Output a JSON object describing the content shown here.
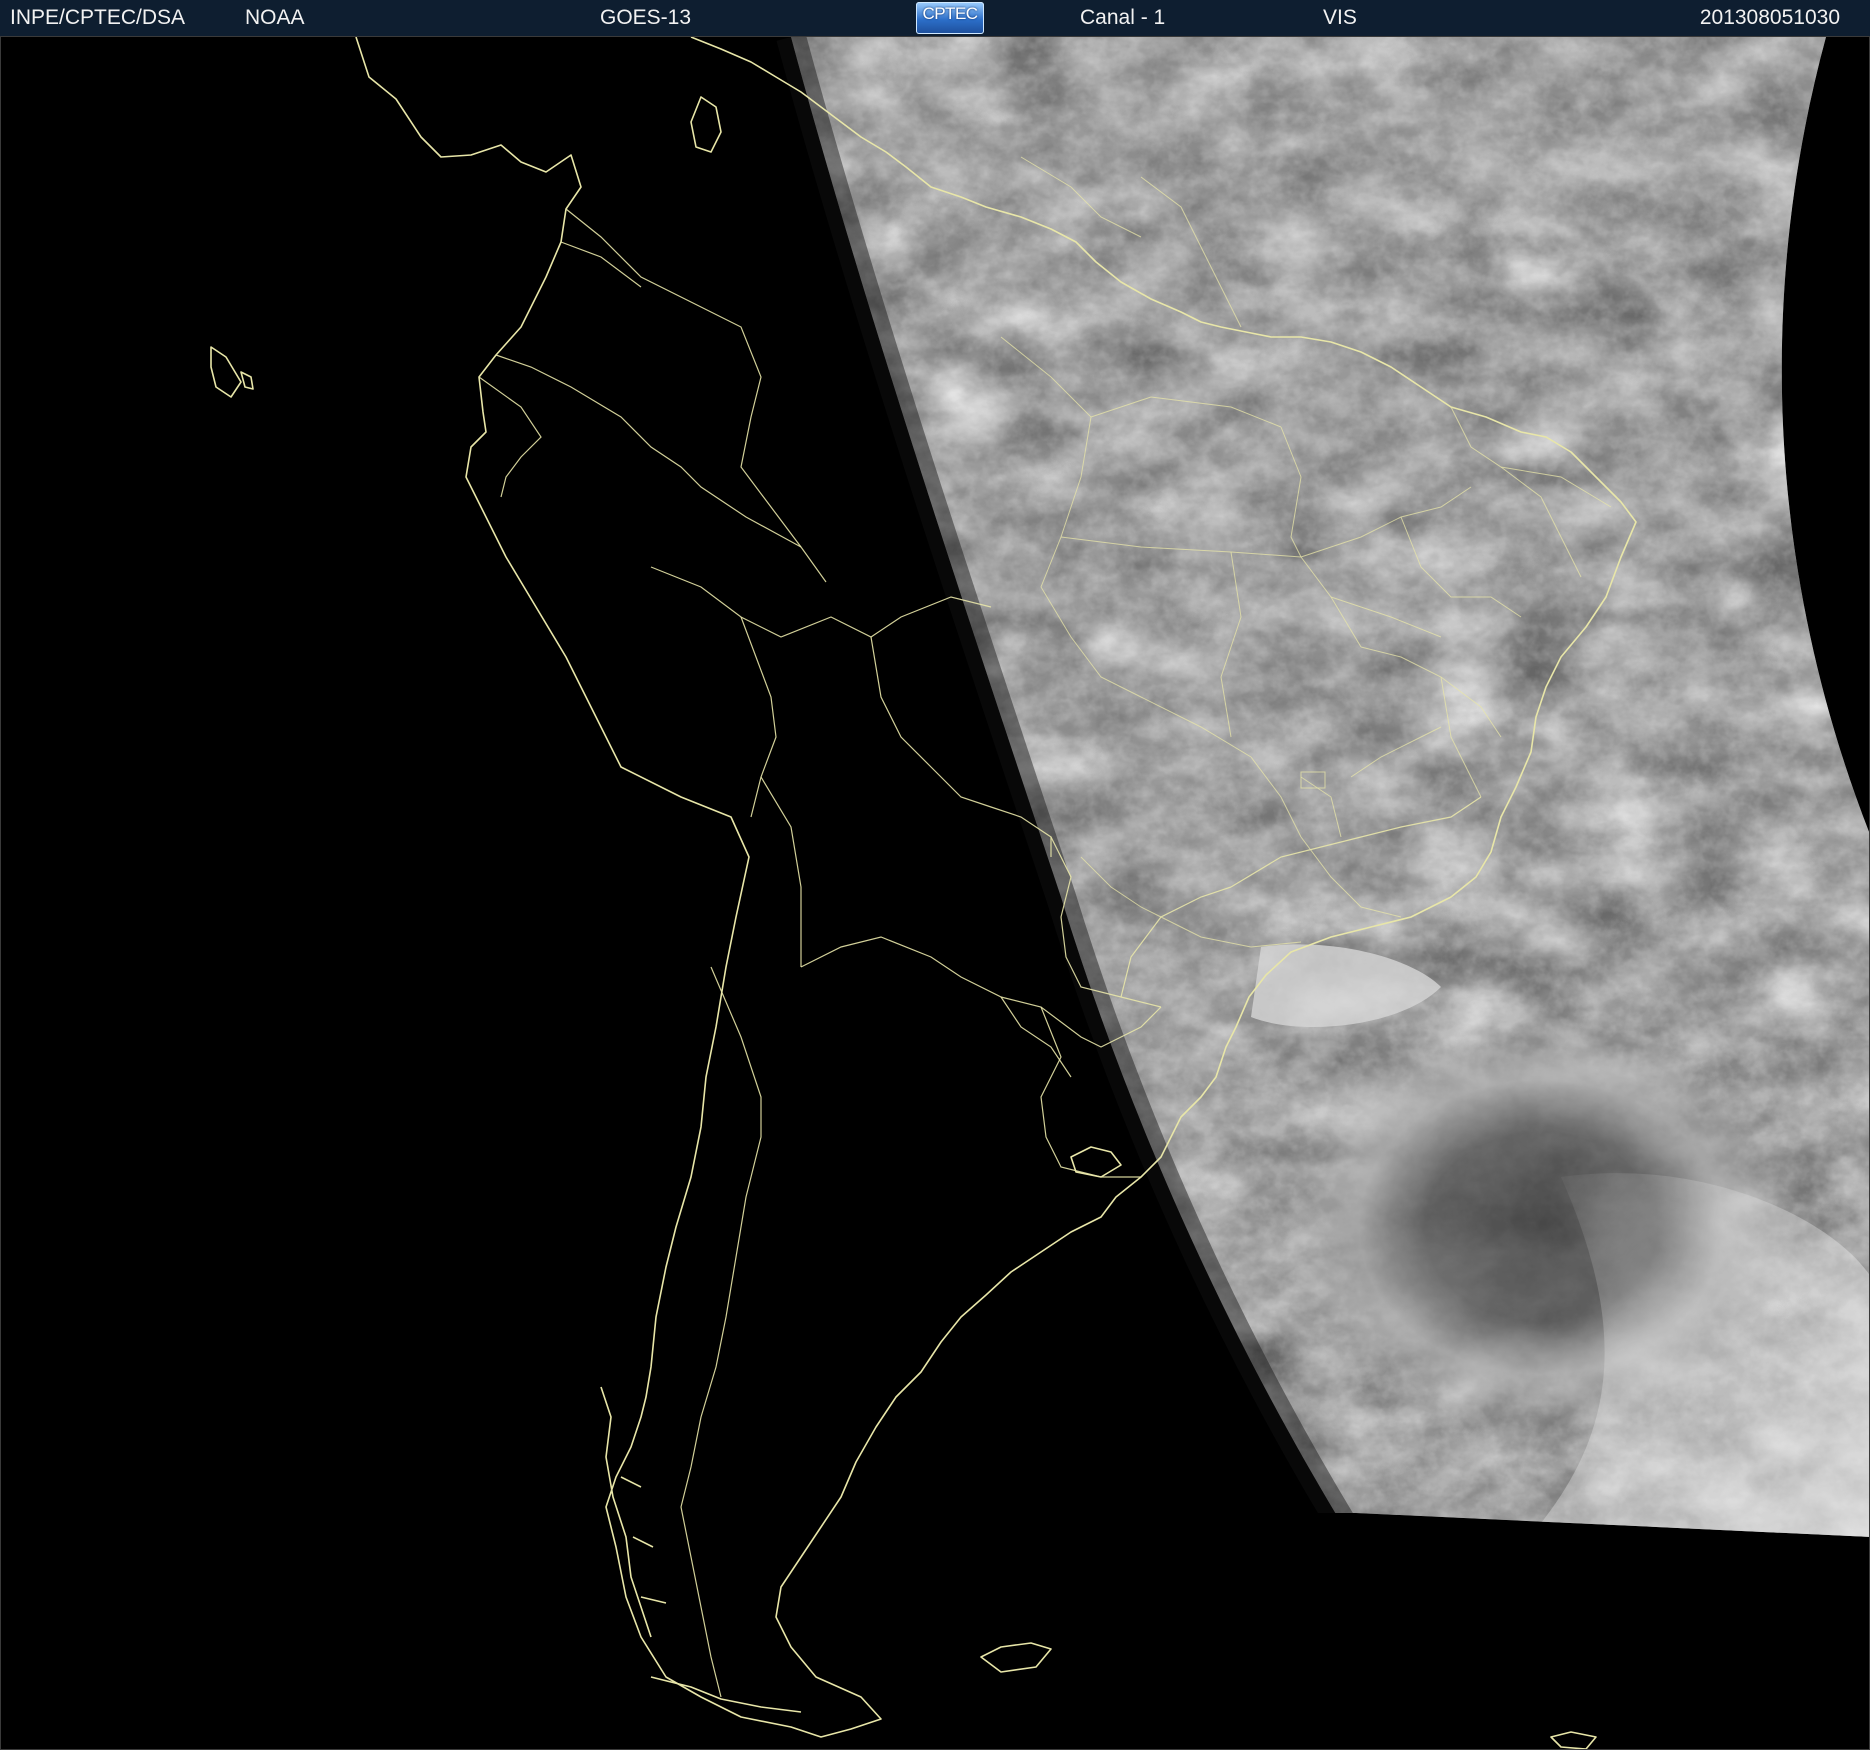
{
  "header": {
    "organization": "INPE/CPTEC/DSA",
    "agency": "NOAA",
    "satellite": "GOES-13",
    "logo_text": "CPTEC",
    "channel": "Canal - 1",
    "band": "VIS",
    "timestamp": "201308051030"
  },
  "map": {
    "coastline_color": "#e8e6a8",
    "background_color": "#000000",
    "imagery": "visible-channel satellite cloud imagery over South America",
    "features": [
      "cloud-field",
      "cyclone-cloud-swirl",
      "day-night-terminator",
      "country-borders",
      "state-borders",
      "coastline"
    ]
  }
}
